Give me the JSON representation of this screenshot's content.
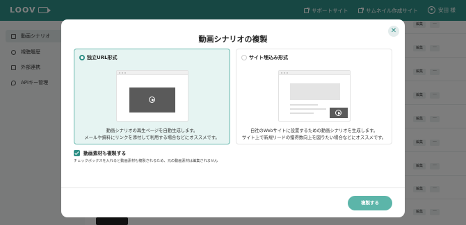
{
  "header": {
    "logo": "LOOV",
    "support_link": "サポートサイト",
    "thumbnail_link": "サムネイル作成サイト",
    "user_name": "安田 様"
  },
  "sidebar": {
    "items": [
      {
        "label": "動画シナリオ",
        "icon": "film-icon",
        "active": true
      },
      {
        "label": "視聴履歴",
        "icon": "person-icon",
        "active": false
      },
      {
        "label": "外部連携",
        "icon": "link-icon",
        "active": false
      },
      {
        "label": "APIキー管理",
        "icon": "key-icon",
        "active": false
      }
    ]
  },
  "background": {
    "edit_label": "編集",
    "more_label": "···"
  },
  "modal": {
    "title": "動画シナリオの複製",
    "close_icon": "close-icon",
    "options": [
      {
        "label": "独立URL形式",
        "selected": true,
        "desc_line1": "動画シナリオの再生ページを自動生成します。",
        "desc_line2": "メールや資料にリンクを添付して利用する場合などにオススメです。"
      },
      {
        "label": "サイト埋込み形式",
        "selected": false,
        "desc_line1": "自社のWebサイトに設置するための動画シナリオを生成します。",
        "desc_line2": "サイト上で新規リードの獲得数向上を図りたい場合などにオススメです。"
      }
    ],
    "copy_materials_label": "動画素材も複製する",
    "copy_materials_checked": true,
    "copy_materials_note": "チェックボックスを入れると動画素材も複製されるため、元の動画素材は編集されません",
    "submit_label": "複製する"
  },
  "colors": {
    "brand": "#2f8f86",
    "submit": "#5cb5a9",
    "selected_bg": "#e6f4f2"
  }
}
